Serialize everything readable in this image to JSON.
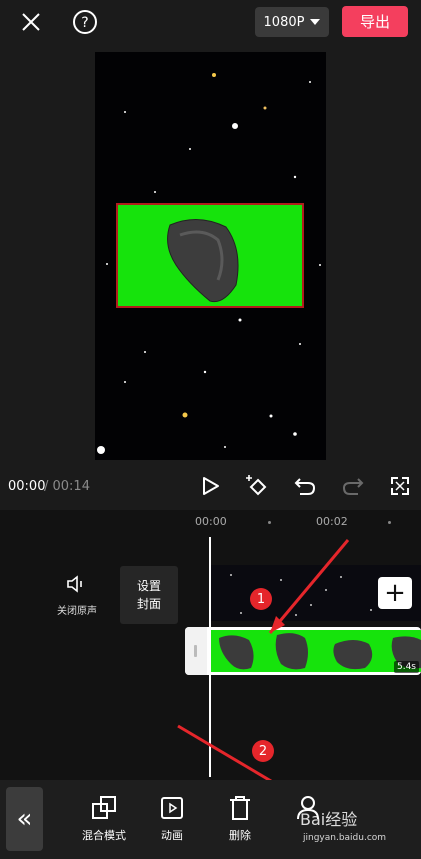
{
  "topbar": {
    "close_icon": "close-icon",
    "help_icon": "help-icon",
    "resolution": "1080P",
    "export_label": "导出"
  },
  "playback": {
    "current_time": "00:00",
    "total_time": "/ 00:14"
  },
  "timeline": {
    "ruler": [
      "00:00",
      "00:02"
    ],
    "mute_label": "关闭原声",
    "cover_label_line1": "设置",
    "cover_label_line2": "封面",
    "clip_duration": "5.4s"
  },
  "annotations": {
    "marker1": "1",
    "marker2": "2",
    "arrow_color": "#e5262b"
  },
  "toolbar": {
    "items": [
      {
        "label": "混合模式",
        "icon": "blend-mode-icon"
      },
      {
        "label": "动画",
        "icon": "animation-icon"
      },
      {
        "label": "删除",
        "icon": "delete-icon"
      }
    ],
    "collapse_icon": "double-chevron-left-icon"
  },
  "watermark": {
    "text": "Bai经验",
    "sub": "jingyan.baidu.com"
  }
}
